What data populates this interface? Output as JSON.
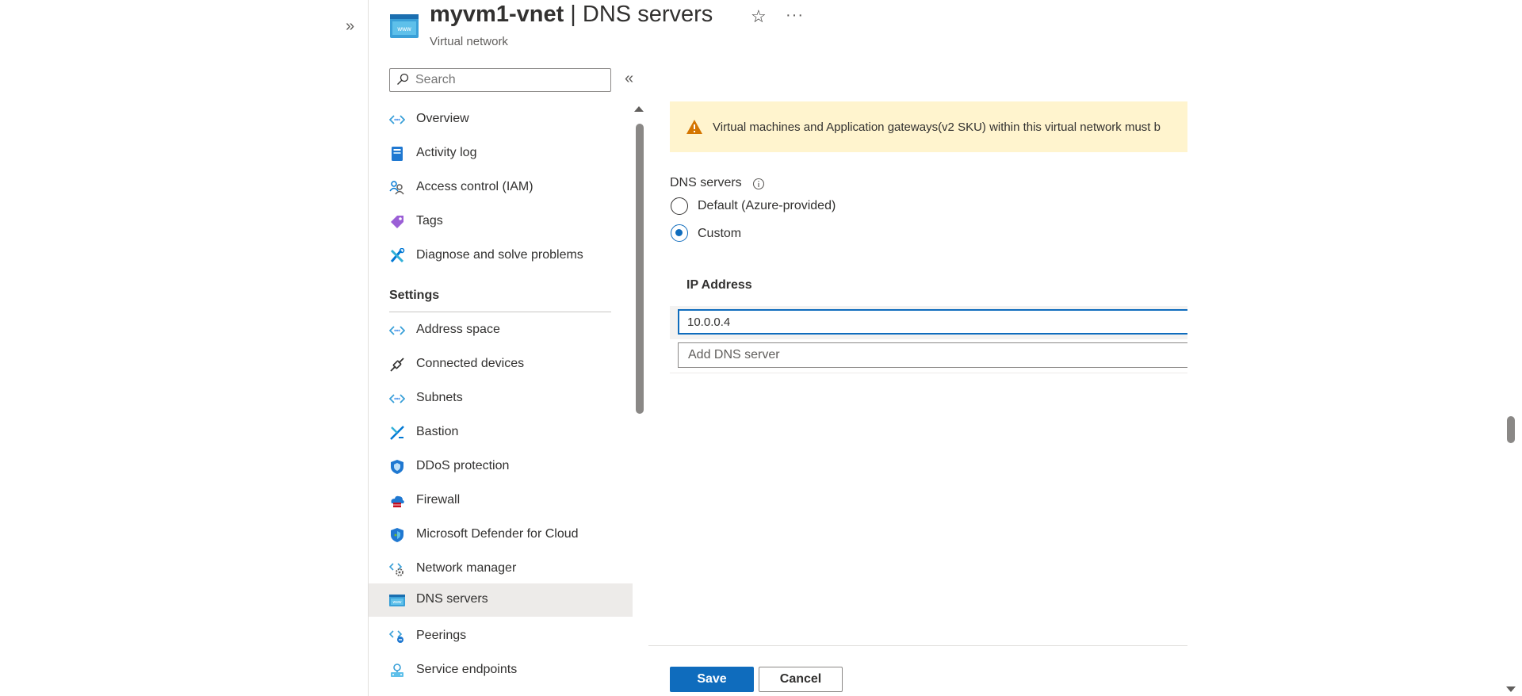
{
  "header": {
    "resource_name": "myvm1-vnet",
    "separator": " | ",
    "page_title": "DNS servers",
    "subtitle": "Virtual network",
    "star_glyph": "☆",
    "more_glyph": "···",
    "expand_glyph": "»",
    "collapse_glyph": "«"
  },
  "search": {
    "placeholder": "Search"
  },
  "sidebar": {
    "items": [
      {
        "label": "Overview",
        "icon": "overview-icon"
      },
      {
        "label": "Activity log",
        "icon": "activity-log-icon"
      },
      {
        "label": "Access control (IAM)",
        "icon": "access-control-icon"
      },
      {
        "label": "Tags",
        "icon": "tag-icon"
      },
      {
        "label": "Diagnose and solve problems",
        "icon": "diagnose-icon"
      }
    ],
    "settings_header": "Settings",
    "settings_items": [
      {
        "label": "Address space",
        "icon": "address-space-icon"
      },
      {
        "label": "Connected devices",
        "icon": "connected-devices-icon"
      },
      {
        "label": "Subnets",
        "icon": "subnets-icon"
      },
      {
        "label": "Bastion",
        "icon": "bastion-icon"
      },
      {
        "label": "DDoS protection",
        "icon": "ddos-shield-icon"
      },
      {
        "label": "Firewall",
        "icon": "firewall-icon"
      },
      {
        "label": "Microsoft Defender for Cloud",
        "icon": "defender-shield-icon"
      },
      {
        "label": "Network manager",
        "icon": "network-manager-icon"
      },
      {
        "label": "DNS servers",
        "icon": "dns-servers-icon",
        "selected": true
      },
      {
        "label": "Peerings",
        "icon": "peerings-icon"
      },
      {
        "label": "Service endpoints",
        "icon": "service-endpoints-icon"
      }
    ]
  },
  "warning": {
    "text": "Virtual machines and Application gateways(v2 SKU) within this virtual network must b",
    "icon": "warning-icon"
  },
  "dns": {
    "label": "DNS servers",
    "options": [
      {
        "label": "Default (Azure-provided)",
        "checked": false
      },
      {
        "label": "Custom",
        "checked": true
      }
    ],
    "ip_header": "IP Address",
    "ip_values": [
      "10.0.0.4"
    ],
    "add_placeholder": "Add DNS server"
  },
  "footer": {
    "save_label": "Save",
    "cancel_label": "Cancel"
  },
  "colors": {
    "primary": "#0f6cbd",
    "warning_bg": "#fff4ce",
    "warning_icon": "#d47500",
    "selected_nav_bg": "#edebe9"
  }
}
